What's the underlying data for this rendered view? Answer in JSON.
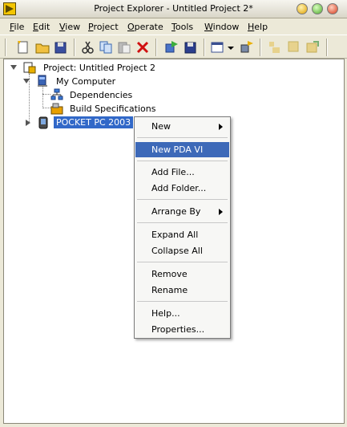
{
  "window": {
    "title": "Project Explorer - Untitled Project 2*"
  },
  "menubar": {
    "items": [
      {
        "u": "F",
        "rest": "ile"
      },
      {
        "u": "E",
        "rest": "dit"
      },
      {
        "u": "V",
        "rest": "iew"
      },
      {
        "u": "P",
        "rest": "roject"
      },
      {
        "u": "O",
        "rest": "perate"
      },
      {
        "u": "T",
        "rest": "ools"
      },
      {
        "u": "W",
        "rest": "indow"
      },
      {
        "u": "H",
        "rest": "elp"
      }
    ]
  },
  "toolbar": {
    "icons": [
      "new-icon",
      "open-icon",
      "save-all-icon",
      "cut-icon",
      "copy-icon",
      "paste-icon",
      "delete-icon",
      "build-icon",
      "save-build-icon",
      "view-icon",
      "dropdown-icon",
      "settings-icon",
      "collapse-icon",
      "expand-icon",
      "refresh-icon"
    ]
  },
  "tree": {
    "project": "Project: Untitled Project 2",
    "my_computer": "My Computer",
    "dependencies": "Dependencies",
    "build_specs": "Build Specifications",
    "target": "POCKET PC 2003"
  },
  "context_menu": {
    "new": "New",
    "new_pda_vi": "New PDA VI",
    "add_file": "Add File...",
    "add_folder": "Add Folder...",
    "arrange_by": "Arrange By",
    "expand_all": "Expand All",
    "collapse_all": "Collapse All",
    "remove": "Remove",
    "rename": "Rename",
    "help": "Help...",
    "properties": "Properties..."
  },
  "colors": {
    "selection": "#3168c8",
    "menu_highlight": "#3d69b8"
  }
}
